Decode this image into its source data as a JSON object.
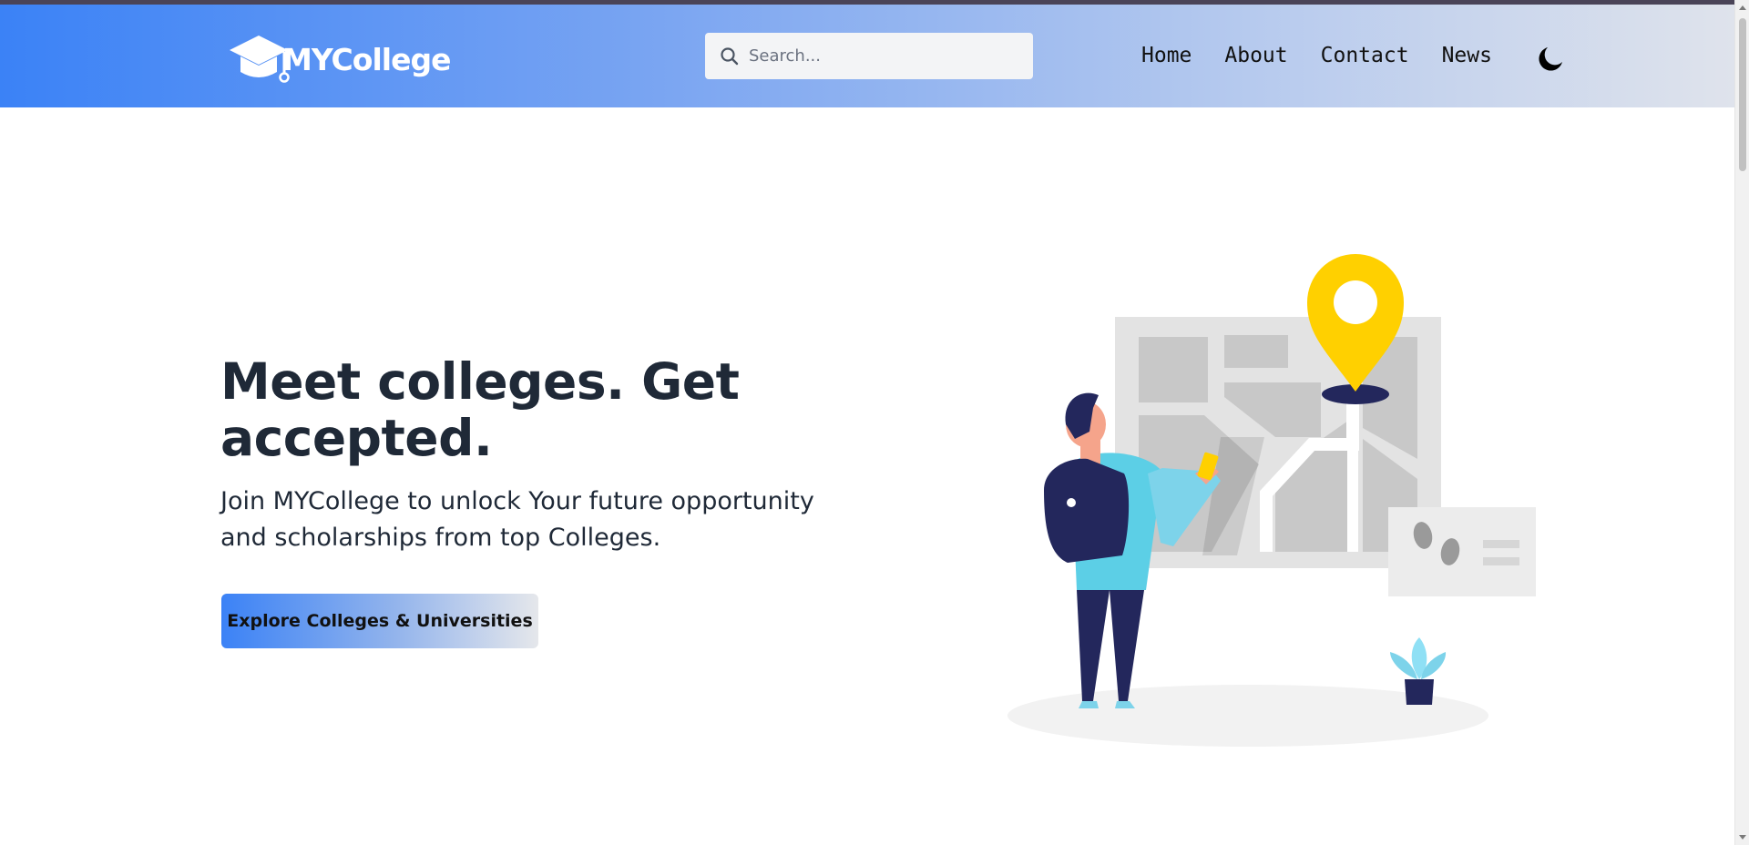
{
  "header": {
    "logo_text": "MYCollege",
    "search_placeholder": "Search...",
    "nav": [
      {
        "label": "Home"
      },
      {
        "label": "About"
      },
      {
        "label": "Contact"
      },
      {
        "label": "News"
      }
    ],
    "theme_icon": "moon-icon"
  },
  "hero": {
    "title": "Meet colleges. Get accepted.",
    "subtitle": "Join MYCollege to unlock Your future opportunity and scholarships from top Colleges.",
    "cta_label": "Explore Colleges & Universities"
  },
  "icons": {
    "logo": "graduation-cap-icon",
    "search": "search-icon",
    "theme": "moon-icon"
  },
  "colors": {
    "brand_blue": "#3b82f6",
    "pin_yellow": "#ffd000",
    "navy": "#23275c",
    "light_blue": "#7dd3ea"
  }
}
